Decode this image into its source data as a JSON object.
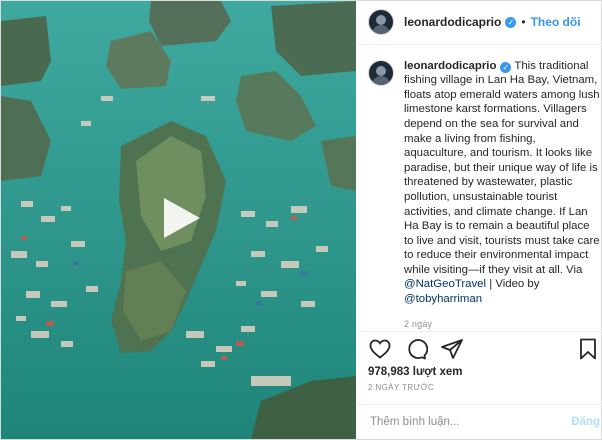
{
  "header": {
    "username": "leonardodicaprio",
    "separator": "•",
    "follow_label": "Theo dõi"
  },
  "caption": {
    "username": "leonardodicaprio",
    "text": " This traditional fishing village in Lan Ha Bay, Vietnam, floats atop emerald waters among lush limestone karst formations. Villagers depend on the sea for survival and make a living from fishing, aquaculture, and tourism. It looks like paradise, but their unique way of life is threatened by wastewater, plastic pollution, unsustainable tourist activities, and climate change. If Lan Ha Bay is to remain a beautiful place to live and visit, tourists must take care to reduce their environmental impact while visiting—if they visit at all. Via ",
    "mention1": "@NatGeoTravel",
    "mid": " | Video by ",
    "mention2": "@tobyharriman",
    "time": "2 ngày"
  },
  "stats": {
    "views": "978,983 lượt xem",
    "ago": "2 NGÀY TRƯỚC"
  },
  "comment": {
    "placeholder": "Thêm bình luận...",
    "post_label": "Đăng"
  },
  "icons": {
    "verified": "verified-badge-icon",
    "play": "play-icon",
    "like": "heart-icon",
    "comment": "comment-icon",
    "share": "send-icon",
    "save": "bookmark-icon"
  },
  "colors": {
    "accent": "#3897f0",
    "water": "#2a8f86"
  }
}
